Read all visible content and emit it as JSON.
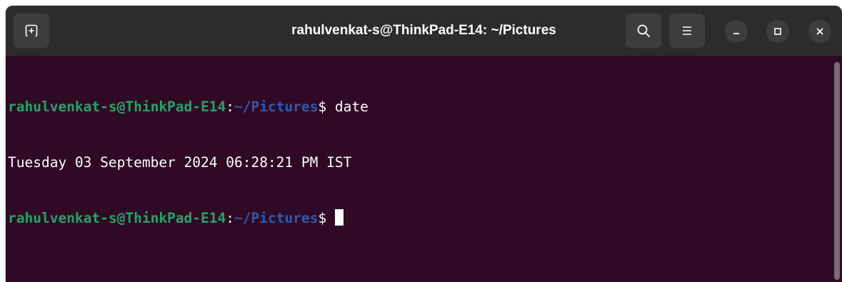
{
  "window": {
    "title": "rahulvenkat-s@ThinkPad-E14: ~/Pictures"
  },
  "toolbar": {
    "new_tab_icon": "new-tab-icon",
    "search_icon": "search-icon",
    "menu_icon": "hamburger-menu-icon",
    "minimize_icon": "minimize-icon",
    "maximize_icon": "maximize-icon",
    "close_icon": "close-icon"
  },
  "terminal": {
    "lines": [
      {
        "user": "rahulvenkat-s@ThinkPad-E14",
        "sep": ":",
        "path": "~/Pictures",
        "prompt": "$ ",
        "command": "date"
      },
      {
        "output": "Tuesday 03 September 2024 06:28:21 PM IST"
      },
      {
        "user": "rahulvenkat-s@ThinkPad-E14",
        "sep": ":",
        "path": "~/Pictures",
        "prompt": "$ ",
        "command": ""
      }
    ]
  },
  "colors": {
    "background": "#300a24",
    "prompt_user": "#26a269",
    "prompt_path": "#2f5aaf",
    "headerbar": "#2c2c2c"
  }
}
